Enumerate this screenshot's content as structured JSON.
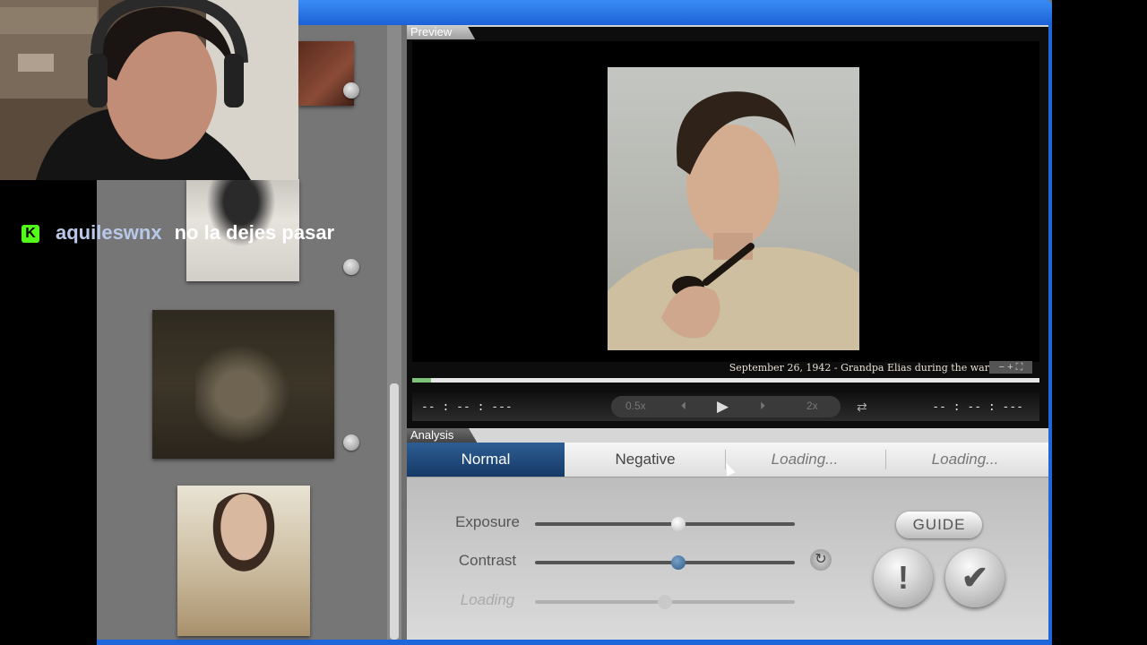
{
  "preview": {
    "panel_title": "Preview",
    "caption": "September 26, 1942 - Grandpa Elias during the war",
    "zoom_control": "− + ⛶",
    "time_left": "-- : -- : ---",
    "time_right": "-- : -- : ---",
    "speed_slow": "0.5x",
    "speed_fast": "2x",
    "progress_fraction": 0.03
  },
  "analysis": {
    "panel_title": "Analysis",
    "tabs": [
      {
        "label": "Normal",
        "selected": true
      },
      {
        "label": "Negative",
        "selected": false
      },
      {
        "label": "Loading...",
        "selected": false
      },
      {
        "label": "Loading...",
        "selected": false
      }
    ],
    "sliders": [
      {
        "label": "Exposure",
        "value": 0.55
      },
      {
        "label": "Contrast",
        "value": 0.55
      },
      {
        "label": "Loading",
        "value": 0.5
      }
    ],
    "guide_label": "GUIDE",
    "alert_label": "!",
    "confirm_label": "✔"
  },
  "chat": {
    "username": "aquileswnx",
    "message": "no la dejes pasar",
    "platform_icon": "K"
  },
  "colors": {
    "titlebar": "#1b62d8",
    "selected_tab": "#1f4a7d",
    "contrast_knob": "#3f6f9c",
    "chat_icon": "#53fc18"
  }
}
